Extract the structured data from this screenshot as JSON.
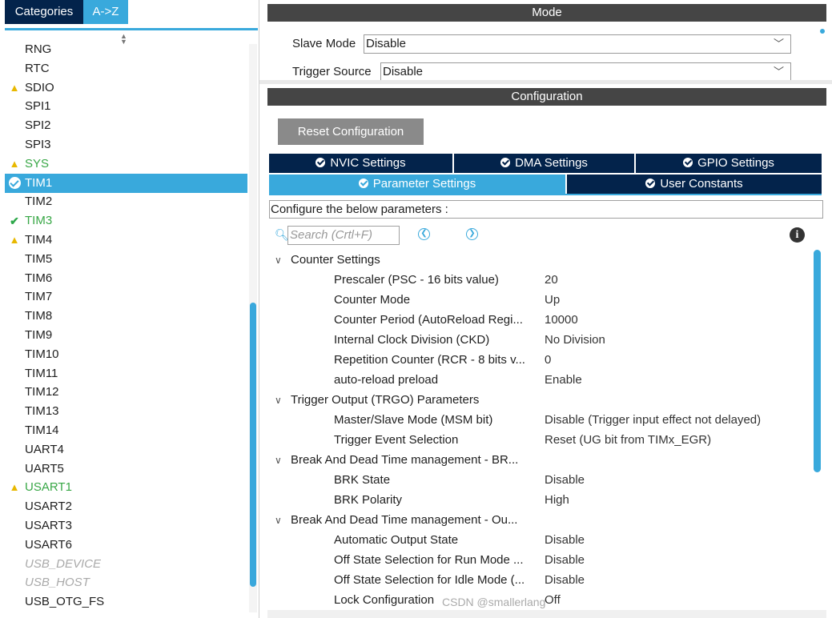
{
  "left_panel": {
    "tabs": {
      "categories": "Categories",
      "a_to_z": "A->Z"
    },
    "items": [
      {
        "label": "RNG",
        "icon": "",
        "style": "normal"
      },
      {
        "label": "RTC",
        "icon": "",
        "style": "normal"
      },
      {
        "label": "SDIO",
        "icon": "warning",
        "style": "normal"
      },
      {
        "label": "SPI1",
        "icon": "",
        "style": "normal"
      },
      {
        "label": "SPI2",
        "icon": "",
        "style": "normal"
      },
      {
        "label": "SPI3",
        "icon": "",
        "style": "normal"
      },
      {
        "label": "SYS",
        "icon": "warning",
        "style": "green"
      },
      {
        "label": "TIM1",
        "icon": "check-circle",
        "style": "selected"
      },
      {
        "label": "TIM2",
        "icon": "",
        "style": "normal"
      },
      {
        "label": "TIM3",
        "icon": "check",
        "style": "green"
      },
      {
        "label": "TIM4",
        "icon": "warning",
        "style": "normal"
      },
      {
        "label": "TIM5",
        "icon": "",
        "style": "normal"
      },
      {
        "label": "TIM6",
        "icon": "",
        "style": "normal"
      },
      {
        "label": "TIM7",
        "icon": "",
        "style": "normal"
      },
      {
        "label": "TIM8",
        "icon": "",
        "style": "normal"
      },
      {
        "label": "TIM9",
        "icon": "",
        "style": "normal"
      },
      {
        "label": "TIM10",
        "icon": "",
        "style": "normal"
      },
      {
        "label": "TIM11",
        "icon": "",
        "style": "normal"
      },
      {
        "label": "TIM12",
        "icon": "",
        "style": "normal"
      },
      {
        "label": "TIM13",
        "icon": "",
        "style": "normal"
      },
      {
        "label": "TIM14",
        "icon": "",
        "style": "normal"
      },
      {
        "label": "UART4",
        "icon": "",
        "style": "normal"
      },
      {
        "label": "UART5",
        "icon": "",
        "style": "normal"
      },
      {
        "label": "USART1",
        "icon": "warning",
        "style": "green"
      },
      {
        "label": "USART2",
        "icon": "",
        "style": "normal"
      },
      {
        "label": "USART3",
        "icon": "",
        "style": "normal"
      },
      {
        "label": "USART6",
        "icon": "",
        "style": "normal"
      },
      {
        "label": "USB_DEVICE",
        "icon": "",
        "style": "disabled"
      },
      {
        "label": "USB_HOST",
        "icon": "",
        "style": "disabled"
      },
      {
        "label": "USB_OTG_FS",
        "icon": "",
        "style": "normal"
      }
    ]
  },
  "mode": {
    "header": "Mode",
    "slave_mode_label": "Slave Mode",
    "slave_mode_value": "Disable",
    "trigger_source_label": "Trigger Source",
    "trigger_source_value": "Disable"
  },
  "configuration": {
    "header": "Configuration",
    "reset_button": "Reset Configuration",
    "tabs_row1": [
      "NVIC Settings",
      "DMA Settings",
      "GPIO Settings"
    ],
    "tabs_row2": [
      "Parameter Settings",
      "User Constants"
    ],
    "configure_text": "Configure the below parameters :",
    "search_placeholder": "Search (Crtl+F)"
  },
  "params": [
    {
      "type": "group",
      "label": "Counter Settings"
    },
    {
      "type": "param",
      "name": "Prescaler (PSC - 16 bits value)",
      "value": "20"
    },
    {
      "type": "param",
      "name": "Counter Mode",
      "value": "Up"
    },
    {
      "type": "param",
      "name": "Counter Period (AutoReload Regi...",
      "value": "10000"
    },
    {
      "type": "param",
      "name": "Internal Clock Division (CKD)",
      "value": "No Division"
    },
    {
      "type": "param",
      "name": "Repetition Counter (RCR - 8 bits v...",
      "value": "0"
    },
    {
      "type": "param",
      "name": "auto-reload preload",
      "value": "Enable"
    },
    {
      "type": "group",
      "label": "Trigger Output (TRGO) Parameters"
    },
    {
      "type": "param",
      "name": "Master/Slave Mode (MSM bit)",
      "value": "Disable (Trigger input effect not delayed)"
    },
    {
      "type": "param",
      "name": "Trigger Event Selection",
      "value": "Reset (UG bit from TIMx_EGR)"
    },
    {
      "type": "group",
      "label": "Break And Dead Time management - BR..."
    },
    {
      "type": "param",
      "name": "BRK State",
      "value": "Disable"
    },
    {
      "type": "param",
      "name": "BRK Polarity",
      "value": "High"
    },
    {
      "type": "group",
      "label": "Break And Dead Time management - Ou..."
    },
    {
      "type": "param",
      "name": "Automatic Output State",
      "value": "Disable"
    },
    {
      "type": "param",
      "name": "Off State Selection for Run Mode ...",
      "value": "Disable"
    },
    {
      "type": "param",
      "name": "Off State Selection for Idle Mode (...",
      "value": "Disable"
    },
    {
      "type": "param",
      "name": "Lock Configuration",
      "value": "Off"
    }
  ],
  "watermark": "CSDN @smallerlang",
  "colors": {
    "accent": "#39a9dc",
    "dark_navy": "#03234b",
    "header_gray": "#454545",
    "warning": "#e8b800",
    "green": "#38a746"
  }
}
